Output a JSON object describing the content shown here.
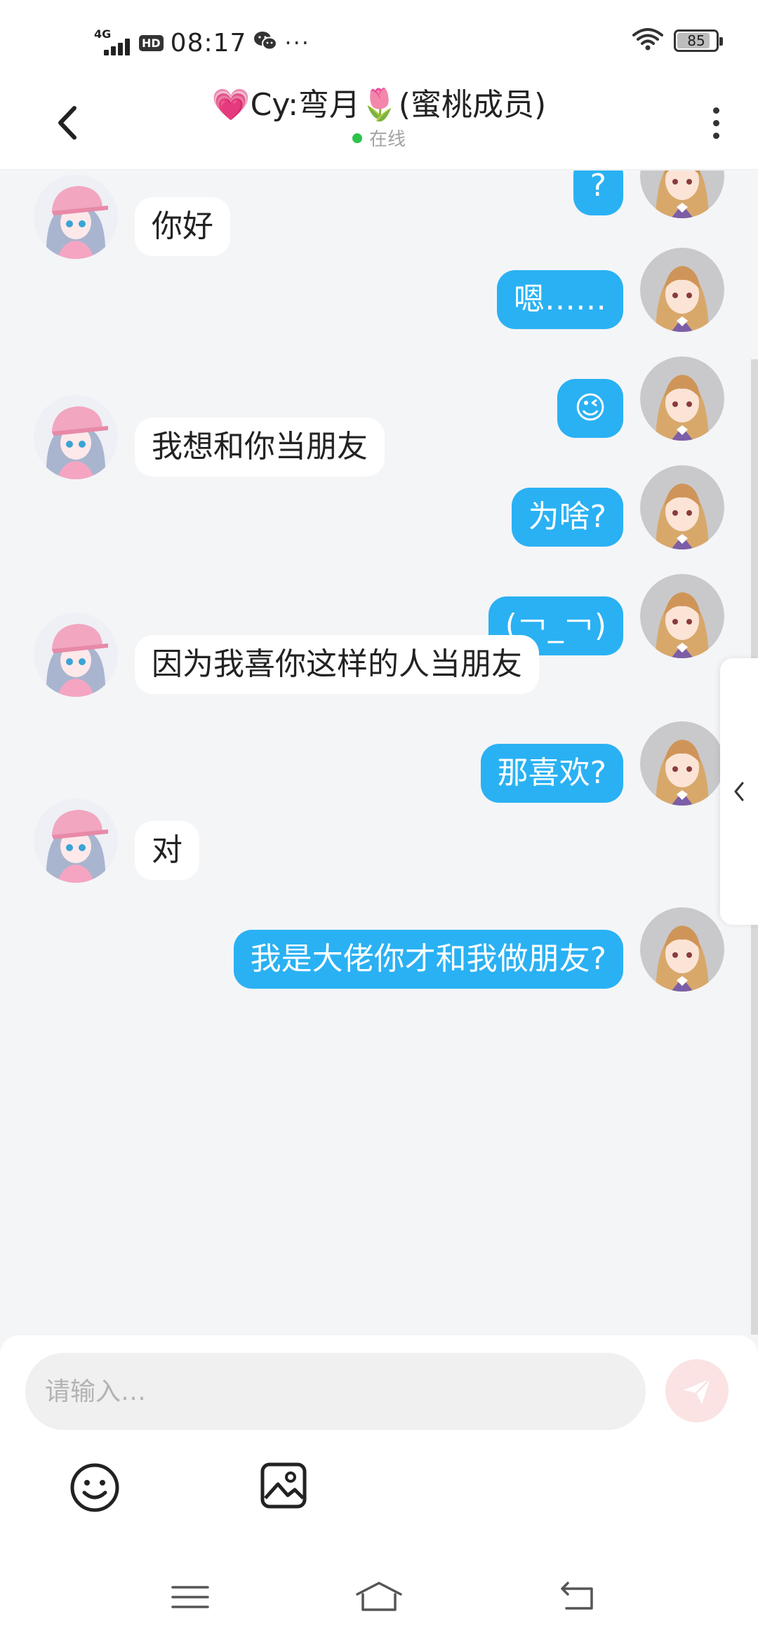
{
  "status_bar": {
    "network": "4G",
    "hd": "HD",
    "time": "08:17",
    "battery": "85",
    "battery_level": 0.85
  },
  "header": {
    "title": "💗Cy:弯月🌷(蜜桃成员)",
    "status": "在线"
  },
  "messages": [
    {
      "from": "me",
      "text": "?"
    },
    {
      "from": "them",
      "text": "你好"
    },
    {
      "from": "me",
      "text": "嗯……"
    },
    {
      "from": "me",
      "text": "😉"
    },
    {
      "from": "them",
      "text": "我想和你当朋友"
    },
    {
      "from": "me",
      "text": "为啥?"
    },
    {
      "from": "me",
      "text": "(￢_￢)"
    },
    {
      "from": "them",
      "text": "因为我喜你这样的人当朋友"
    },
    {
      "from": "me",
      "text": "那喜欢?"
    },
    {
      "from": "them",
      "text": "对"
    },
    {
      "from": "me",
      "text": "我是大佬你才和我做朋友?"
    }
  ],
  "input": {
    "placeholder": "请输入…"
  },
  "colors": {
    "my_bubble": "#2ab1f3",
    "their_bubble": "#ffffff",
    "online": "#2bc44a",
    "background": "#f4f5f7"
  }
}
